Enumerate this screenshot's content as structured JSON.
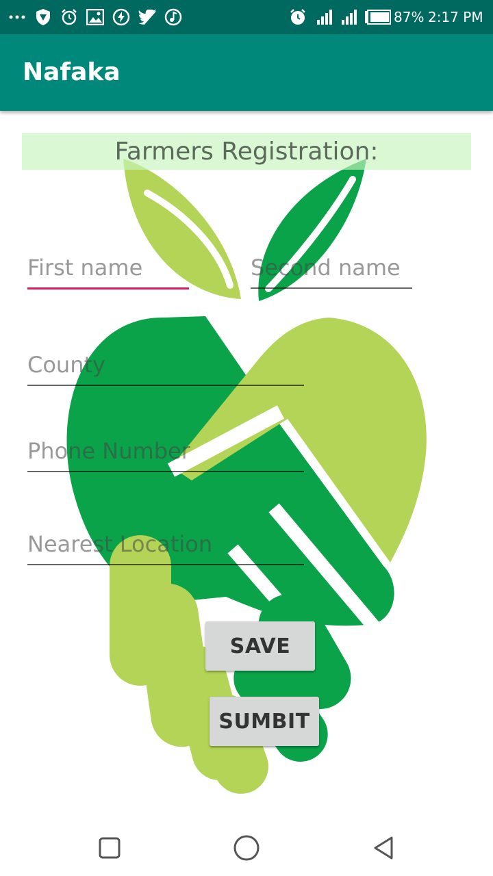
{
  "status_bar": {
    "battery": "87%",
    "time": "2:17 PM",
    "icons": [
      "more-dots-icon",
      "shield-icon",
      "alarm-icon",
      "image-icon",
      "flash-icon",
      "twitter-icon",
      "music-icon",
      "alarm-icon",
      "signal-icon",
      "signal-icon",
      "battery-icon"
    ]
  },
  "app_bar": {
    "title": "Nafaka",
    "color": "#00897b",
    "status_color": "#00695f"
  },
  "form": {
    "title": "Farmers Registration:",
    "first_name_placeholder": "First name",
    "second_name_placeholder": "Second name",
    "county_placeholder": "County",
    "phone_placeholder": "Phone Number",
    "location_placeholder": "Nearest Location",
    "focus_color": "#d81b60"
  },
  "buttons": {
    "save": "SAVE",
    "submit": "SUMBIT"
  },
  "nav_bar": {
    "icons": [
      "recent-apps-icon",
      "home-icon",
      "back-icon"
    ]
  }
}
